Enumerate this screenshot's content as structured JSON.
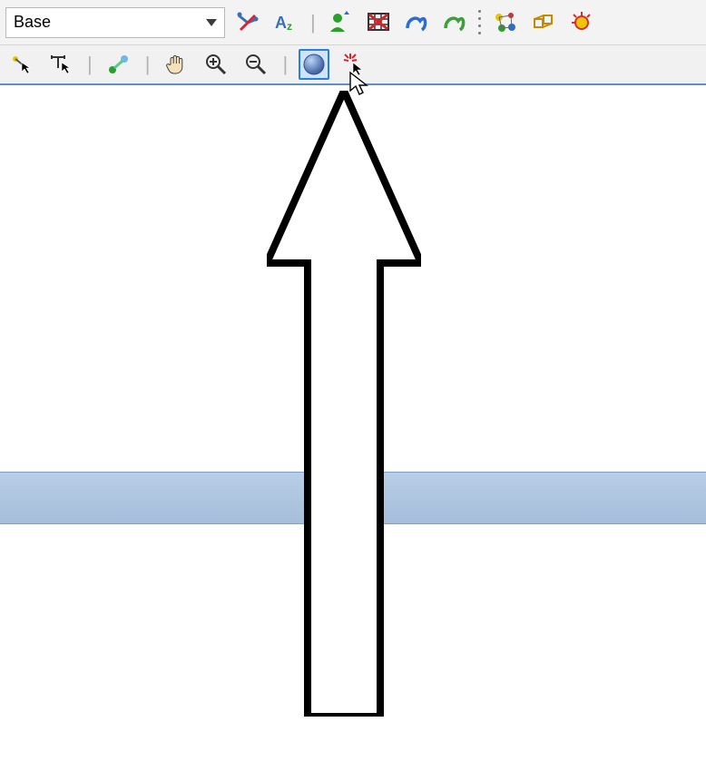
{
  "toolbar": {
    "combo_value": "Base",
    "icons": [
      {
        "name": "hide-atom-icon"
      },
      {
        "name": "atom-label-icon"
      },
      {
        "name": "person-icon"
      },
      {
        "name": "table-delete-icon"
      },
      {
        "name": "link-blue-icon"
      },
      {
        "name": "link-green-icon"
      },
      {
        "name": "color-atoms-icon"
      },
      {
        "name": "structure-icon"
      },
      {
        "name": "sun-icon"
      }
    ]
  },
  "toolbar2": {
    "icons": [
      {
        "name": "select-arrow-icon"
      },
      {
        "name": "measure-arrow-icon"
      },
      {
        "name": "bond-tool-icon"
      },
      {
        "name": "pan-hand-icon"
      },
      {
        "name": "zoom-in-icon"
      },
      {
        "name": "zoom-out-icon"
      },
      {
        "name": "zoom-fit-icon",
        "active": true
      },
      {
        "name": "spark-cursor-icon"
      }
    ]
  }
}
